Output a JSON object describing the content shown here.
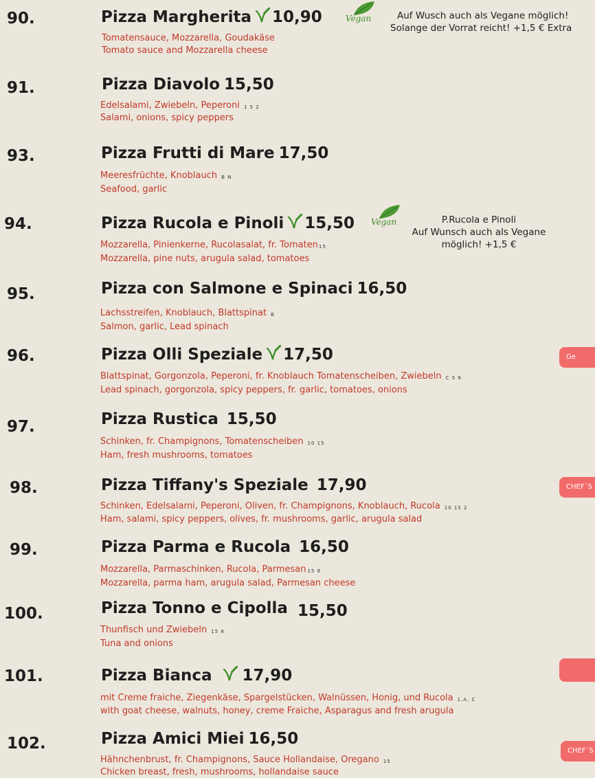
{
  "items": [
    {
      "num": "90.",
      "name": "Pizza Margherita",
      "price": "10,90",
      "de": "Tomatensauce, Mozzarella, Goudakäse",
      "codes": "",
      "en": "Tomato sauce and Mozzarella cheese"
    },
    {
      "num": "91.",
      "name": "Pizza Diavolo",
      "price": "15,50",
      "de": "Edelsalami, Zwiebeln, Peperoni",
      "codes": "1 5 2",
      "en": "Salami, onions, spicy peppers"
    },
    {
      "num": "93.",
      "name": "Pizza Frutti di Mare",
      "price": "17,50",
      "de": "Meeresfrüchte, Knoblauch",
      "codes": "B N",
      "en": "Seafood, garlic"
    },
    {
      "num": "94.",
      "name": "Pizza Rucola e Pinoli",
      "price": "15,50",
      "de": "Mozzarella, Pinienkerne, Rucolasalat, fr. Tomaten",
      "codes": "15",
      "en": "Mozzarella, pine nuts, arugula salad, tomatoes"
    },
    {
      "num": "95.",
      "name": "Pizza con Salmone e Spinaci",
      "price": "16,50",
      "de": "Lachsstreifen, Knoblauch, Blattspinat",
      "codes": "B",
      "en": "Salmon, garlic, Lead spinach"
    },
    {
      "num": "96.",
      "name": "Pizza Olli Speziale",
      "price": "17,50",
      "de": "Blattspinat, Gorgonzola, Peperoni, fr. Knoblauch Tomatenscheiben, Zwiebeln",
      "codes": "C 5 8",
      "en": "Lead spinach, gorgonzola, spicy peppers, fr. garlic, tomatoes, onions"
    },
    {
      "num": "97.",
      "name": "Pizza Rustica",
      "price": "15,50",
      "de": "Schinken, fr. Champignons, Tomatenscheiben",
      "codes": "10 15",
      "en": "Ham, fresh mushrooms, tomatoes"
    },
    {
      "num": "98.",
      "name": "Pizza Tiffany's Speziale",
      "price": "17,90",
      "de": "Schinken, Edelsalami, Peperoni, Oliven, fr. Champignons, Knoblauch, Rucola",
      "codes": "10 15 2",
      "en": "Ham, salami, spicy peppers, olives, fr. mushrooms, garlic, arugula salad"
    },
    {
      "num": "99.",
      "name": "Pizza Parma e Rucola",
      "price": "16,50",
      "de": "Mozzarella, Parmaschinken, Rucola, Parmesan",
      "codes": "15 8",
      "en": "Mozzarella, parma ham, arugula salad, Parmesan cheese"
    },
    {
      "num": "100.",
      "name": "Pizza Tonno e Cipolla",
      "price": "15,50",
      "de": "Thunfisch und Zwiebeln",
      "codes": "15 8",
      "en": "Tuna and onions"
    },
    {
      "num": "101.",
      "name": "Pizza Bianca",
      "price": "17,90",
      "de": "mit Creme fraiche,  Ziegenkäse, Spargelstücken, Walnüssen, Honig, und Rucola",
      "codes": "1,A, C",
      "en": "with goat cheese, walnuts, honey, creme Fraiche, Asparagus and fresh arugula"
    },
    {
      "num": "102.",
      "name": "Pizza Amici Miei",
      "price": "16,50",
      "de": "Hähnchenbrust, fr. Champignons, Sauce Hollandaise, Oregano",
      "codes": "15",
      "en": "Chicken breast, fresh, mushrooms, hollandaise sauce"
    }
  ],
  "notes": {
    "margherita_line1": "Auf Wusch auch als Vegane möglich!",
    "margherita_line2": "Solange der Vorrat reicht! +1,5 € Extra",
    "rucola_line1": "P.Rucola e Pinoli",
    "rucola_line2": "Auf Wunsch auch als Vegane",
    "rucola_line3": "möglich! +1,5 €"
  },
  "vegan_logo_text": "Vegan",
  "badges": {
    "b96": "Ge",
    "b98": "CHEF´S",
    "b101": "",
    "b102": "CHEF´S"
  },
  "colors": {
    "background": "#ece7dc",
    "description": "#c0392b",
    "leaf_green": "#3f8f2c",
    "badge": "#f26b6b"
  },
  "icons": {
    "vegan_mark": "leaf-icon",
    "vegan_logo": "vegan-logo"
  }
}
